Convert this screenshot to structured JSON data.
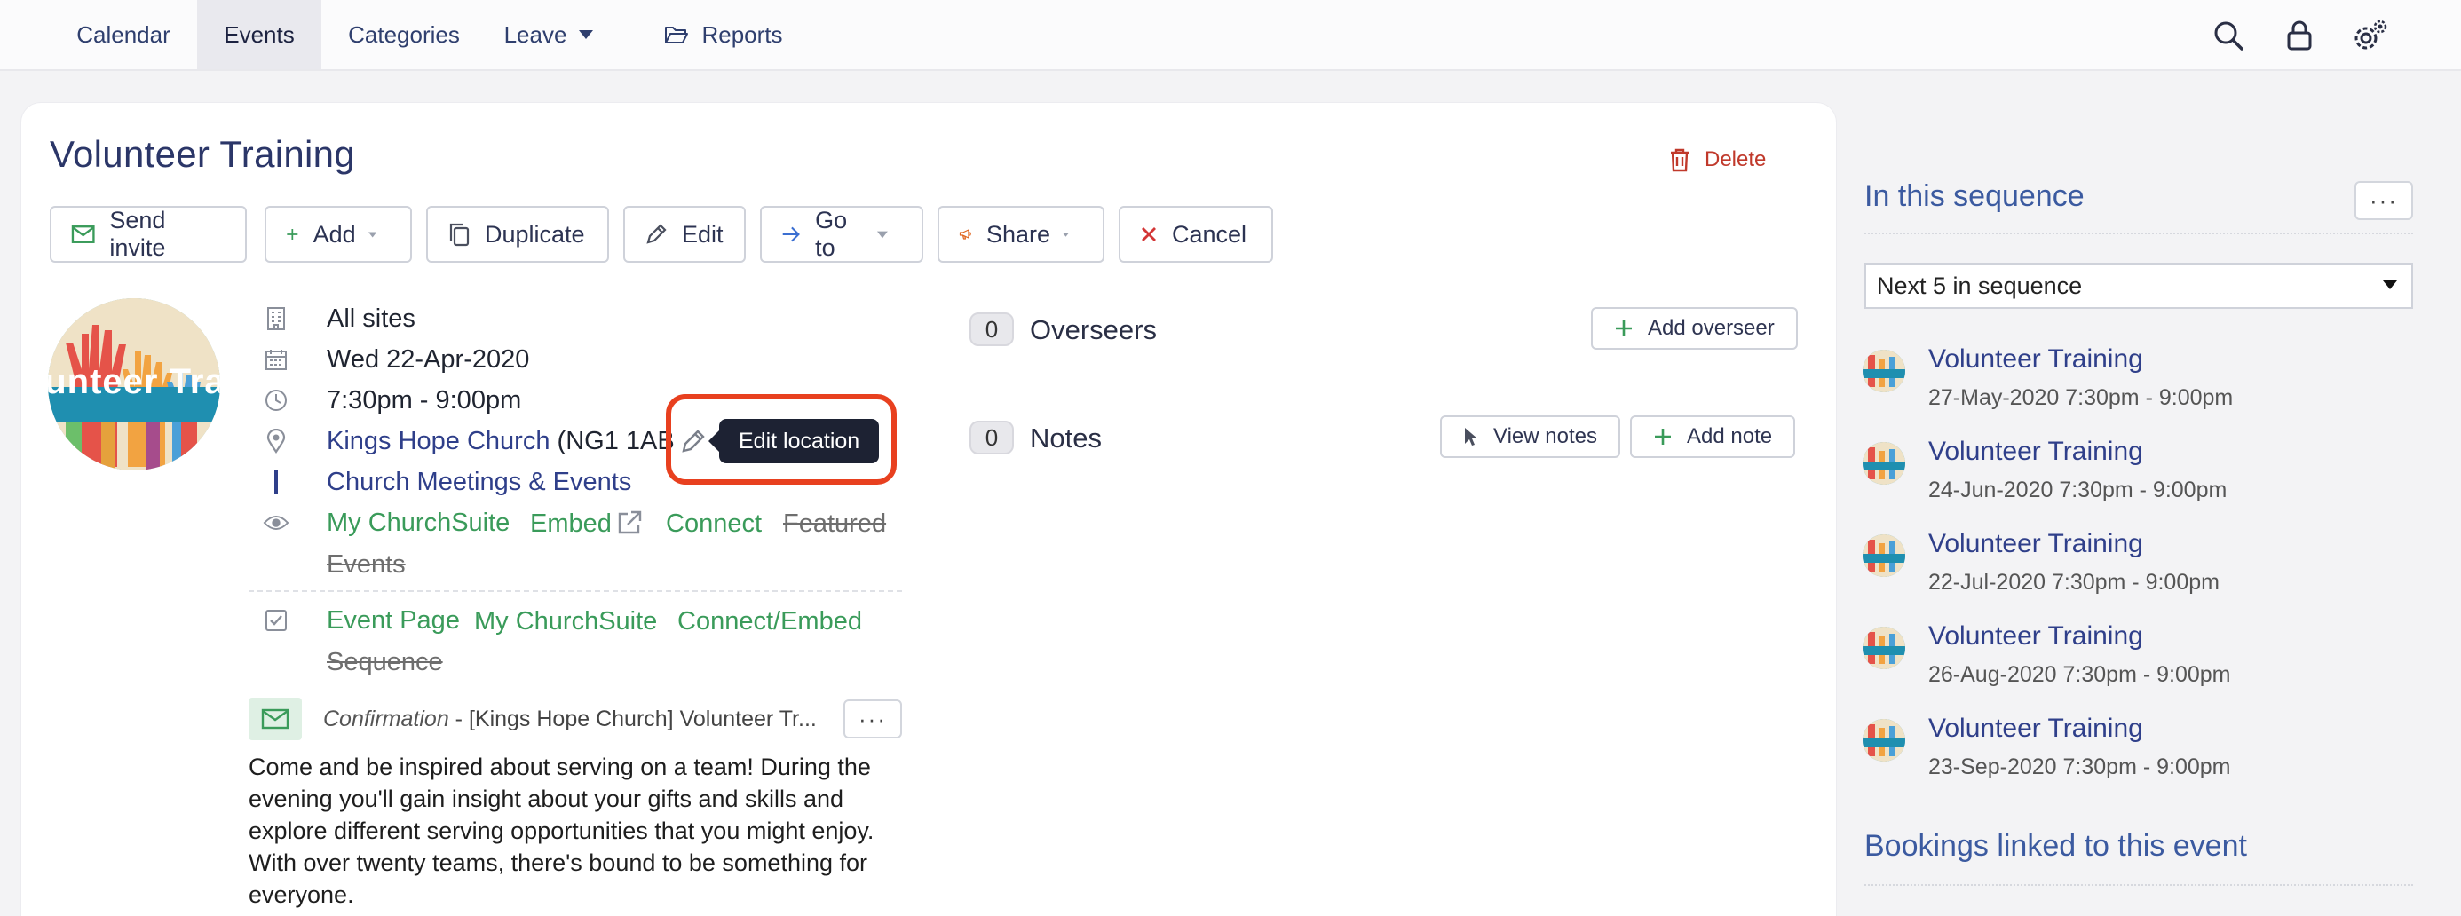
{
  "nav": {
    "tabs": [
      {
        "label": "Calendar"
      },
      {
        "label": "Events"
      },
      {
        "label": "Categories"
      },
      {
        "label": "Leave"
      },
      {
        "label": "Reports"
      }
    ]
  },
  "event": {
    "title": "Volunteer Training",
    "delete_label": "Delete",
    "avatar_text": "unteer Trai",
    "actions": {
      "send_invite": "Send invite",
      "add": "Add",
      "duplicate": "Duplicate",
      "edit": "Edit",
      "go_to": "Go to",
      "share": "Share",
      "cancel": "Cancel"
    },
    "details": {
      "sites": "All sites",
      "date": "Wed 22-Apr-2020",
      "time": "7:30pm - 9:00pm",
      "location_name": "Kings Hope Church",
      "location_postcode": " (NG1 1AB",
      "category": "Church Meetings & Events",
      "visibility": {
        "my_churchsuite": "My ChurchSuite",
        "embed": "Embed",
        "connect": "Connect",
        "featured": "Featured",
        "events": "Events"
      },
      "sequence_links": {
        "event_page": "Event Page",
        "my_churchsuite": "My ChurchSuite",
        "connect_embed": "Connect/Embed",
        "sequence": "Sequence"
      }
    },
    "tooltip": "Edit location",
    "confirmation": {
      "label": "Confirmation",
      "subject": " - [Kings Hope Church] Volunteer Tr..."
    },
    "description": "Come and be inspired about serving on a team! During the evening you'll gain insight about your gifts and skills and explore different serving opportunities that you might enjoy. With over twenty teams, there's bound to be something for everyone.",
    "overseers": {
      "count": "0",
      "label": "Overseers",
      "add_button": "Add overseer"
    },
    "notes": {
      "count": "0",
      "label": "Notes",
      "view_button": "View notes",
      "add_button": "Add note"
    }
  },
  "sequence": {
    "title": "In this sequence",
    "select_value": "Next 5 in sequence",
    "items": [
      {
        "title": "Volunteer Training",
        "date": "27-May-2020 7:30pm - 9:00pm"
      },
      {
        "title": "Volunteer Training",
        "date": "24-Jun-2020 7:30pm - 9:00pm"
      },
      {
        "title": "Volunteer Training",
        "date": "22-Jul-2020 7:30pm - 9:00pm"
      },
      {
        "title": "Volunteer Training",
        "date": "26-Aug-2020 7:30pm - 9:00pm"
      },
      {
        "title": "Volunteer Training",
        "date": "23-Sep-2020 7:30pm - 9:00pm"
      }
    ],
    "bookings_title": "Bookings linked to this event"
  },
  "colors": {
    "accent_blue": "#2f3f8a",
    "green": "#3a9b5a",
    "danger": "#c0392b",
    "highlight": "#e8401f"
  }
}
